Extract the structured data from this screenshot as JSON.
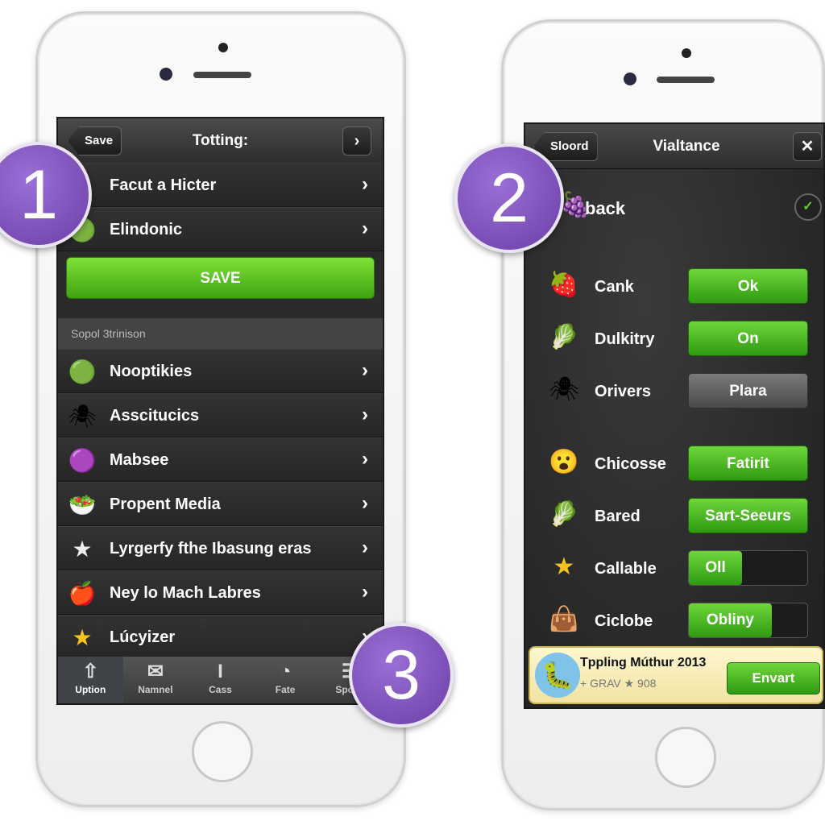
{
  "phone1": {
    "header": {
      "back_label": "Save",
      "title": "Totting:",
      "forward_icon": "chevron-right"
    },
    "top_rows": [
      {
        "label": "Facut a Hicter",
        "icon": "fruit"
      },
      {
        "label": "Elindonic",
        "icon": "green-blob"
      }
    ],
    "save_button": "SAVE",
    "section_title": "Sopol 3trinison",
    "rows": [
      {
        "label": "Nooptikies",
        "icon": "green-blob"
      },
      {
        "label": "Asscitucics",
        "icon": "purple-bug"
      },
      {
        "label": "Mabsee",
        "icon": "purple-orb"
      },
      {
        "label": "Propent Media",
        "icon": "food-plate"
      },
      {
        "label": "Lyrgerfy fthe Ibasung eras",
        "icon": "silver-star"
      },
      {
        "label": "Ney lo Mach Labres",
        "icon": "red-apple"
      },
      {
        "label": "Lúcyizer",
        "icon": "gold-star"
      }
    ],
    "tabs": [
      {
        "label": "Uption",
        "icon": "upload",
        "active": true
      },
      {
        "label": "Namnel",
        "icon": "mail"
      },
      {
        "label": "Cass",
        "icon": "cursor"
      },
      {
        "label": "Fate",
        "icon": "dial"
      },
      {
        "label": "Spope",
        "icon": "menu"
      }
    ]
  },
  "phone2": {
    "header": {
      "back_label": "Sloord",
      "title": "Vialtance",
      "close_icon": "close"
    },
    "top_row": {
      "label": "back",
      "checked": true
    },
    "rows": [
      {
        "label": "Cank",
        "icon": "strawberry",
        "control": "button",
        "value": "Ok",
        "color": "#4bbd21"
      },
      {
        "label": "Dulkitry",
        "icon": "leaf",
        "control": "button",
        "value": "On",
        "color": "#4bbd21"
      },
      {
        "label": "Orivers",
        "icon": "purple-bug",
        "control": "button",
        "value": "Plara",
        "color": "#5e5e5e"
      },
      {
        "label": "Chicosse",
        "icon": "emoji",
        "control": "button",
        "value": "Fatirit",
        "color": "#4bbd21"
      },
      {
        "label": "Bared",
        "icon": "leaf",
        "control": "button",
        "value": "Sart-Seeurs",
        "color": "#4bbd21"
      },
      {
        "label": "Callable",
        "icon": "gold-star",
        "control": "toggle",
        "value": "Oll",
        "fill": 0.45
      },
      {
        "label": "Ciclobe",
        "icon": "sack",
        "control": "toggle",
        "value": "Obliny",
        "fill": 0.7
      }
    ],
    "ad": {
      "title": "Tppling Múthur 2013",
      "subtitle": "+ GRAV ★ 908",
      "button": "Envart"
    }
  },
  "badges": [
    "1",
    "2",
    "3"
  ],
  "colors": {
    "badge": "#7b4fb8",
    "green": "#4bbd21",
    "screen": "#2b2b2b"
  }
}
